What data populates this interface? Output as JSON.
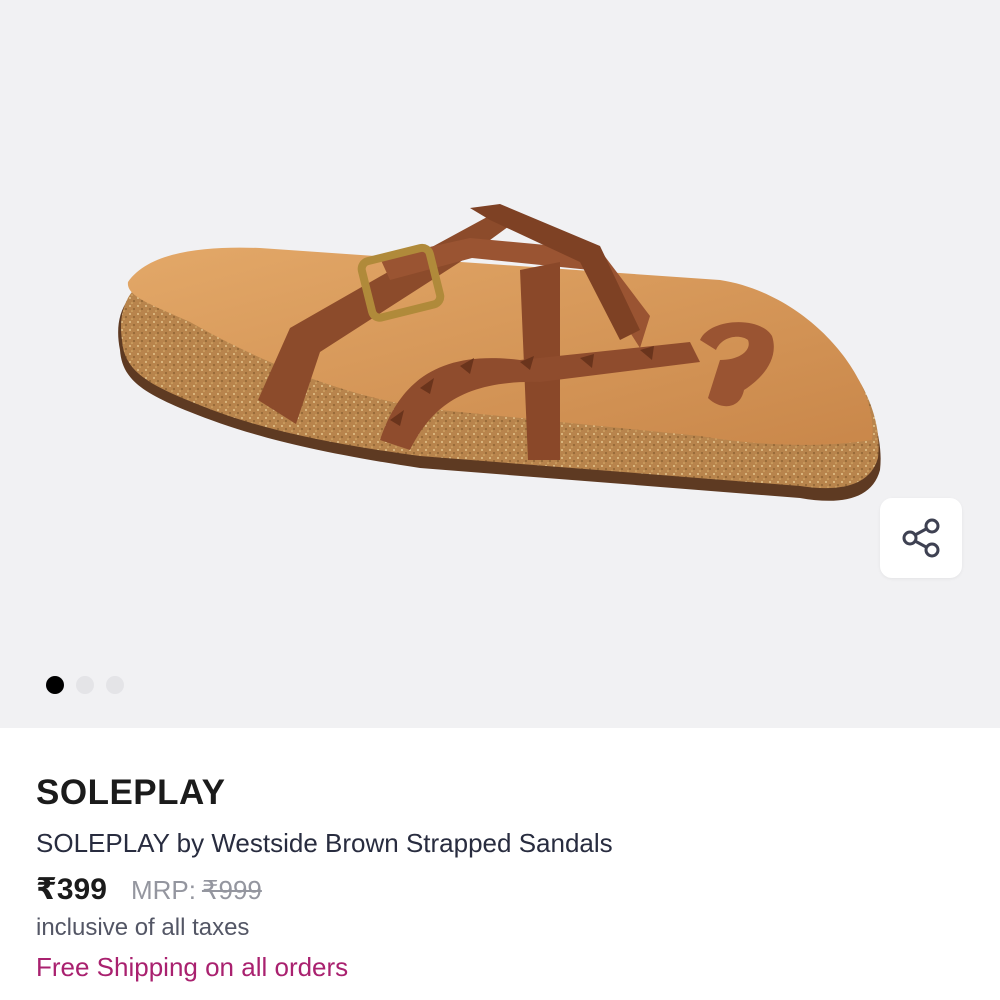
{
  "product": {
    "brand": "SOLEPLAY",
    "name": "SOLEPLAY by Westside Brown Strapped Sandals",
    "price": "₹399",
    "mrp_label": "MRP:",
    "mrp_value": "₹999",
    "tax_note": "inclusive of all taxes",
    "shipping_note": "Free Shipping on all orders"
  },
  "gallery": {
    "image_count": 3,
    "active_index": 0,
    "share_icon": "share-icon"
  },
  "colors": {
    "gallery_bg": "#f1f1f3",
    "shipping_accent": "#a9216f",
    "strap": "#8a4a2b",
    "footbed": "#d99a5a",
    "cork": "#b9854f"
  }
}
